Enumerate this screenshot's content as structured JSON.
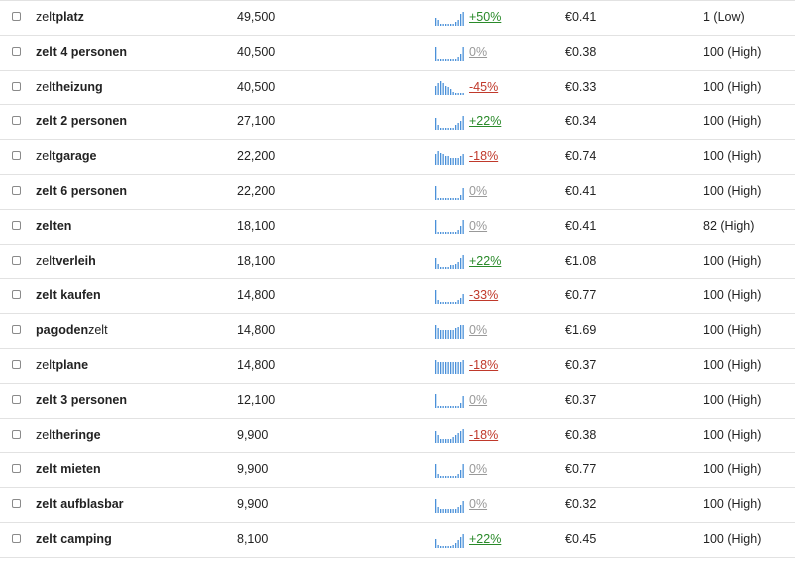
{
  "colors": {
    "spark": "#4a90d9",
    "up": "#2a8a2a",
    "down": "#c0392b",
    "zero": "#999999"
  },
  "rows": [
    {
      "kw": [
        {
          "t": "zelt",
          "b": false
        },
        {
          "t": "platz",
          "b": true
        }
      ],
      "volume": "49,500",
      "change": "+50%",
      "dir": "up",
      "spark": [
        4,
        3,
        1,
        1,
        1,
        1,
        1,
        1,
        2,
        3,
        6,
        7
      ],
      "cpc": "€0.41",
      "competition": "1 (Low)"
    },
    {
      "kw": [
        {
          "t": "zelt ",
          "b": true
        },
        {
          "t": "4 personen",
          "b": true
        }
      ],
      "volume": "40,500",
      "change": "0%",
      "dir": "zero",
      "spark": [
        8,
        1,
        1,
        1,
        1,
        1,
        1,
        1,
        1,
        2,
        4,
        8
      ],
      "cpc": "€0.38",
      "competition": "100 (High)"
    },
    {
      "kw": [
        {
          "t": "zelt",
          "b": false
        },
        {
          "t": "heizung",
          "b": true
        }
      ],
      "volume": "40,500",
      "change": "-45%",
      "dir": "down",
      "spark": [
        6,
        8,
        9,
        8,
        6,
        5,
        4,
        2,
        1,
        1,
        1,
        1
      ],
      "cpc": "€0.33",
      "competition": "100 (High)"
    },
    {
      "kw": [
        {
          "t": "zelt 2 personen",
          "b": true
        }
      ],
      "volume": "27,100",
      "change": "+22%",
      "dir": "up",
      "spark": [
        5,
        2,
        1,
        1,
        1,
        1,
        1,
        1,
        2,
        3,
        4,
        6
      ],
      "cpc": "€0.34",
      "competition": "100 (High)"
    },
    {
      "kw": [
        {
          "t": "zelt",
          "b": false
        },
        {
          "t": "garage",
          "b": true
        }
      ],
      "volume": "22,200",
      "change": "-18%",
      "dir": "down",
      "spark": [
        6,
        8,
        7,
        6,
        5,
        5,
        4,
        4,
        4,
        4,
        5,
        6
      ],
      "cpc": "€0.74",
      "competition": "100 (High)"
    },
    {
      "kw": [
        {
          "t": "zelt 6 personen",
          "b": true
        }
      ],
      "volume": "22,200",
      "change": "0%",
      "dir": "zero",
      "spark": [
        8,
        1,
        1,
        1,
        1,
        1,
        1,
        1,
        1,
        1,
        3,
        7
      ],
      "cpc": "€0.41",
      "competition": "100 (High)"
    },
    {
      "kw": [
        {
          "t": "zelten",
          "b": true
        }
      ],
      "volume": "18,100",
      "change": "0%",
      "dir": "zero",
      "spark": [
        7,
        1,
        1,
        1,
        1,
        1,
        1,
        1,
        1,
        2,
        4,
        7
      ],
      "cpc": "€0.41",
      "competition": "82 (High)"
    },
    {
      "kw": [
        {
          "t": "zelt",
          "b": false
        },
        {
          "t": "verleih",
          "b": true
        }
      ],
      "volume": "18,100",
      "change": "+22%",
      "dir": "up",
      "spark": [
        6,
        3,
        1,
        1,
        1,
        1,
        2,
        2,
        3,
        4,
        6,
        8
      ],
      "cpc": "€1.08",
      "competition": "100 (High)"
    },
    {
      "kw": [
        {
          "t": "zelt kaufen",
          "b": true
        }
      ],
      "volume": "14,800",
      "change": "-33%",
      "dir": "down",
      "spark": [
        7,
        2,
        1,
        1,
        1,
        1,
        1,
        1,
        1,
        2,
        3,
        5
      ],
      "cpc": "€0.77",
      "competition": "100 (High)"
    },
    {
      "kw": [
        {
          "t": "pagoden",
          "b": true
        },
        {
          "t": "zelt",
          "b": false
        }
      ],
      "volume": "14,800",
      "change": "0%",
      "dir": "zero",
      "spark": [
        8,
        6,
        5,
        5,
        5,
        5,
        5,
        5,
        6,
        7,
        8,
        8
      ],
      "cpc": "€1.69",
      "competition": "100 (High)"
    },
    {
      "kw": [
        {
          "t": "zelt",
          "b": false
        },
        {
          "t": "plane",
          "b": true
        }
      ],
      "volume": "14,800",
      "change": "-18%",
      "dir": "down",
      "spark": [
        8,
        7,
        7,
        7,
        7,
        7,
        7,
        7,
        7,
        7,
        7,
        8
      ],
      "cpc": "€0.37",
      "competition": "100 (High)"
    },
    {
      "kw": [
        {
          "t": "zelt 3 personen",
          "b": true
        }
      ],
      "volume": "12,100",
      "change": "0%",
      "dir": "zero",
      "spark": [
        8,
        1,
        1,
        1,
        1,
        1,
        1,
        1,
        1,
        1,
        3,
        7
      ],
      "cpc": "€0.37",
      "competition": "100 (High)"
    },
    {
      "kw": [
        {
          "t": "zelt",
          "b": false
        },
        {
          "t": "heringe",
          "b": true
        }
      ],
      "volume": "9,900",
      "change": "-18%",
      "dir": "down",
      "spark": [
        6,
        4,
        2,
        2,
        2,
        2,
        2,
        3,
        4,
        5,
        6,
        7
      ],
      "cpc": "€0.38",
      "competition": "100 (High)"
    },
    {
      "kw": [
        {
          "t": "zelt mieten",
          "b": true
        }
      ],
      "volume": "9,900",
      "change": "0%",
      "dir": "zero",
      "spark": [
        7,
        2,
        1,
        1,
        1,
        1,
        1,
        1,
        1,
        2,
        4,
        7
      ],
      "cpc": "€0.77",
      "competition": "100 (High)"
    },
    {
      "kw": [
        {
          "t": "zelt aufblasbar",
          "b": true
        }
      ],
      "volume": "9,900",
      "change": "0%",
      "dir": "zero",
      "spark": [
        7,
        3,
        2,
        2,
        2,
        2,
        2,
        2,
        2,
        3,
        4,
        6
      ],
      "cpc": "€0.32",
      "competition": "100 (High)"
    },
    {
      "kw": [
        {
          "t": "zelt camping",
          "b": true
        }
      ],
      "volume": "8,100",
      "change": "+22%",
      "dir": "up",
      "spark": [
        6,
        2,
        1,
        1,
        1,
        1,
        1,
        2,
        3,
        5,
        7,
        9
      ],
      "cpc": "€0.45",
      "competition": "100 (High)"
    }
  ]
}
